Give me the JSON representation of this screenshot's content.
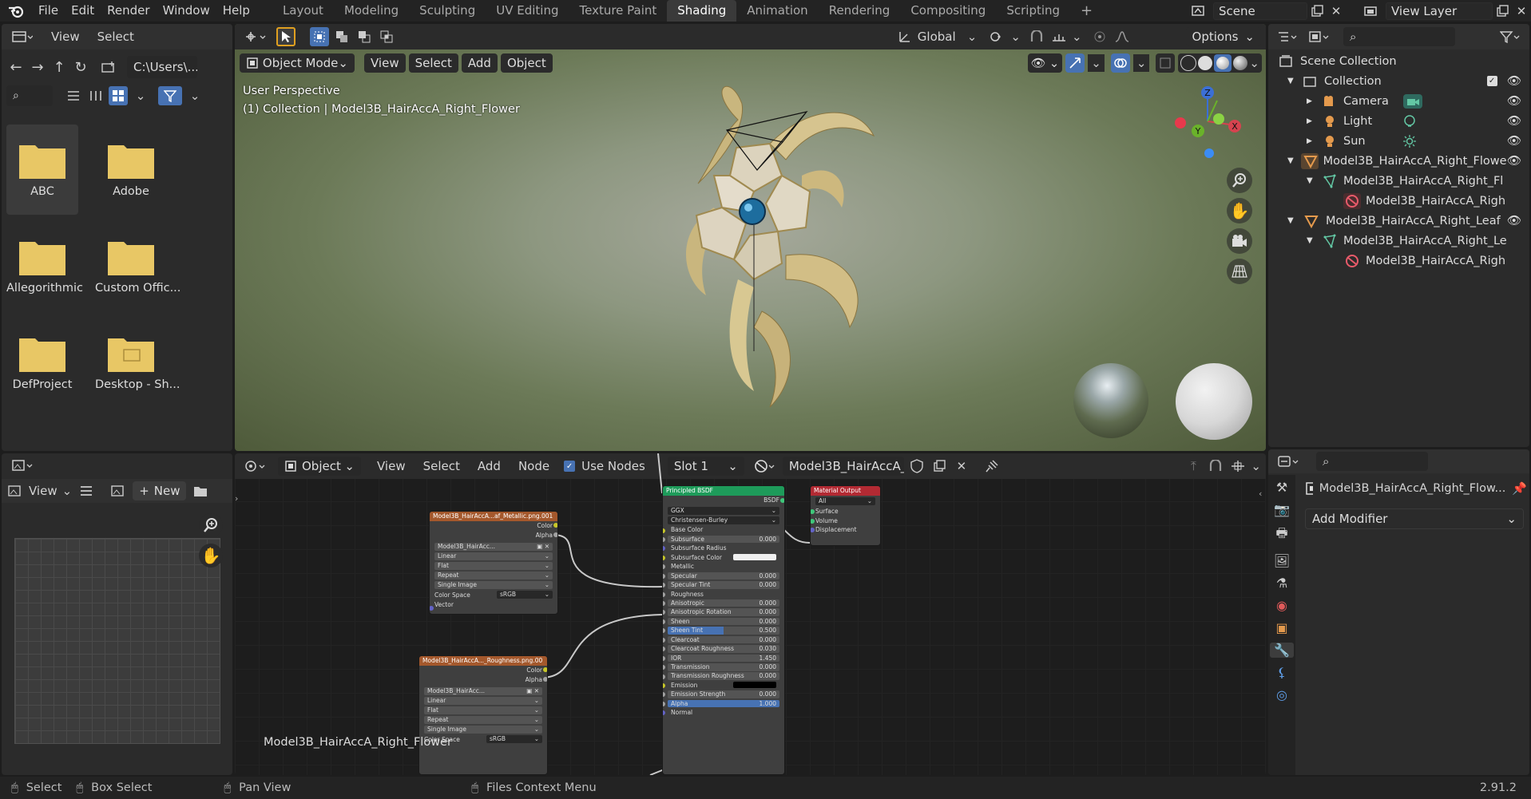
{
  "app_logo": "blender-logo",
  "menu": [
    "File",
    "Edit",
    "Render",
    "Window",
    "Help"
  ],
  "workspaces": [
    "Layout",
    "Modeling",
    "Sculpting",
    "UV Editing",
    "Texture Paint",
    "Shading",
    "Animation",
    "Rendering",
    "Compositing",
    "Scripting"
  ],
  "active_workspace": "Shading",
  "scene": {
    "label": "Scene"
  },
  "view_layer": {
    "label": "View Layer"
  },
  "file_browser": {
    "menu": [
      "View",
      "Select"
    ],
    "path": "C:\\Users\\...",
    "folders": [
      "ABC",
      "Adobe",
      "Allegorithmic",
      "Custom Offic...",
      "DefProject",
      "Desktop - Sh..."
    ]
  },
  "image_editor": {
    "view_label": "View",
    "new_label": "New"
  },
  "viewport": {
    "mode": "Object Mode",
    "menu": [
      "View",
      "Select",
      "Add",
      "Object"
    ],
    "transform_orientation": "Global",
    "options_label": "Options",
    "perspective_label": "User Perspective",
    "collection_label": "(1) Collection | Model3B_HairAccA_Right_Flower",
    "gizmo": {
      "x": "X",
      "y": "Y",
      "z": "Z"
    }
  },
  "outliner": {
    "rows": [
      {
        "label": "Scene Collection",
        "icon": "scene-collection-icon"
      },
      {
        "label": "Collection",
        "icon": "collection-icon"
      },
      {
        "label": "Camera",
        "icon": "camera-object-icon"
      },
      {
        "label": "Light",
        "icon": "light-object-icon"
      },
      {
        "label": "Sun",
        "icon": "sun-object-icon"
      },
      {
        "label": "Model3B_HairAccA_Right_Flowe",
        "icon": "mesh-object-icon"
      },
      {
        "label": "Model3B_HairAccA_Right_Fl",
        "icon": "mesh-data-icon"
      },
      {
        "label": "Model3B_HairAccA_Righ",
        "icon": "material-icon"
      },
      {
        "label": "Model3B_HairAccA_Right_Leaf",
        "icon": "mesh-object-icon"
      },
      {
        "label": "Model3B_HairAccA_Right_Le",
        "icon": "mesh-data-icon"
      },
      {
        "label": "Model3B_HairAccA_Righ",
        "icon": "material-icon"
      }
    ]
  },
  "node_editor": {
    "object_label": "Object",
    "menu": [
      "View",
      "Select",
      "Add",
      "Node"
    ],
    "use_nodes_label": "Use Nodes",
    "slot_label": "Slot 1",
    "material_label": "Model3B_HairAccA_...",
    "object_caption": "Model3B_HairAccA_Right_Flower",
    "metallic_node": {
      "title": "Model3B_HairAccA...af_Metallic.png.001",
      "outputs": [
        "Color",
        "Alpha"
      ],
      "image": "Model3B_HairAcc...",
      "fields": [
        "Linear",
        "Flat",
        "Repeat",
        "Single Image"
      ],
      "color_space_label": "Color Space",
      "color_space": "sRGB",
      "vector_label": "Vector"
    },
    "roughness_node": {
      "title": "Model3B_HairAccA..._Roughness.png.00",
      "outputs": [
        "Color",
        "Alpha"
      ],
      "image": "Model3B_HairAcc...",
      "fields": [
        "Linear",
        "Flat",
        "Repeat",
        "Single Image"
      ],
      "color_space_label": "Color Space",
      "color_space": "sRGB"
    },
    "bsdf_node": {
      "title": "Principled BSDF",
      "output": "BSDF",
      "distribution": "GGX",
      "subsurface_method": "Christensen-Burley",
      "rows": [
        {
          "label": "Base Color",
          "value": ""
        },
        {
          "label": "Subsurface",
          "value": "0.000"
        },
        {
          "label": "Subsurface Radius",
          "value": ""
        },
        {
          "label": "Subsurface Color",
          "value": ""
        },
        {
          "label": "Metallic",
          "value": ""
        },
        {
          "label": "Specular",
          "value": "0.000"
        },
        {
          "label": "Specular Tint",
          "value": "0.000"
        },
        {
          "label": "Roughness",
          "value": ""
        },
        {
          "label": "Anisotropic",
          "value": "0.000"
        },
        {
          "label": "Anisotropic Rotation",
          "value": "0.000"
        },
        {
          "label": "Sheen",
          "value": "0.000"
        },
        {
          "label": "Sheen Tint",
          "value": "0.500"
        },
        {
          "label": "Clearcoat",
          "value": "0.000"
        },
        {
          "label": "Clearcoat Roughness",
          "value": "0.030"
        },
        {
          "label": "IOR",
          "value": "1.450"
        },
        {
          "label": "Transmission",
          "value": "0.000"
        },
        {
          "label": "Transmission Roughness",
          "value": "0.000"
        },
        {
          "label": "Emission",
          "value": ""
        },
        {
          "label": "Emission Strength",
          "value": "0.000"
        },
        {
          "label": "Alpha",
          "value": "1.000"
        },
        {
          "label": "Normal",
          "value": ""
        }
      ]
    },
    "output_node": {
      "title": "Material Output",
      "target": "All",
      "inputs": [
        "Surface",
        "Volume",
        "Displacement"
      ]
    }
  },
  "properties": {
    "object_name": "Model3B_HairAccA_Right_Flow...",
    "add_modifier_label": "Add Modifier"
  },
  "statusbar": {
    "select": "Select",
    "box_select": "Box Select",
    "pan_view": "Pan View",
    "context_menu": "Files Context Menu",
    "version": "2.91.2"
  },
  "colors": {
    "accent": "#4772b3",
    "image_node_header": "#a4582c",
    "bsdf_node_header": "#1e9b5a",
    "output_node_header": "#b32a33",
    "folder": "#e8c765"
  }
}
